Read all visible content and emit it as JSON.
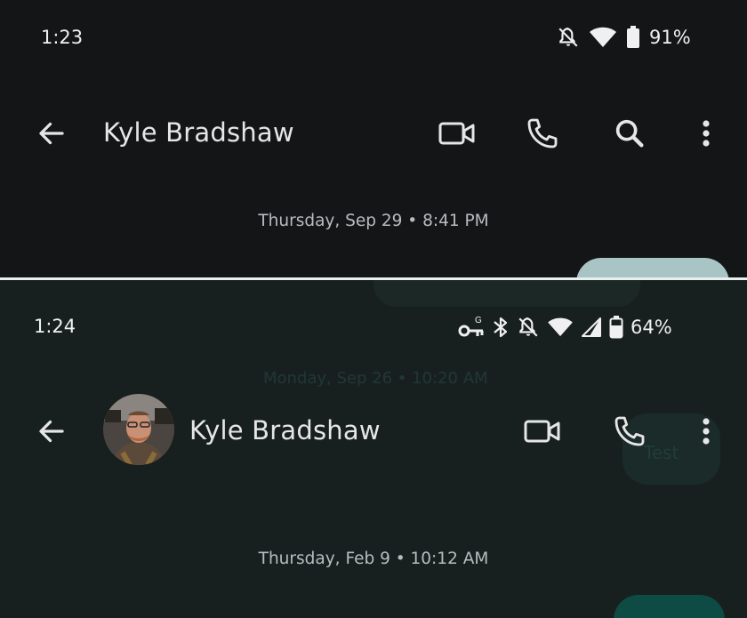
{
  "top": {
    "status": {
      "time": "1:23",
      "battery": "91%"
    },
    "contact_name": "Kyle Bradshaw",
    "date_stamp": "Thursday, Sep 29 • 8:41 PM",
    "icons": [
      "back-arrow-icon",
      "video-call-icon",
      "phone-icon",
      "search-icon",
      "more-vert-icon"
    ]
  },
  "bottom": {
    "status": {
      "time": "1:24",
      "battery": "64%"
    },
    "contact_name": "Kyle Bradshaw",
    "date_stamp": "Thursday, Feb 9 • 10:12 AM",
    "faded_date_stamp": "Monday, Sep 26 • 10:20 AM",
    "faded_bubble_text": "Test",
    "icons": [
      "back-arrow-icon",
      "video-call-icon",
      "phone-icon",
      "more-vert-icon"
    ]
  },
  "colors": {
    "top_background": "#131517",
    "bottom_background": "#17201f",
    "bubble_top": "#a9c4c4",
    "bubble_bottom": "#0e4b45"
  }
}
